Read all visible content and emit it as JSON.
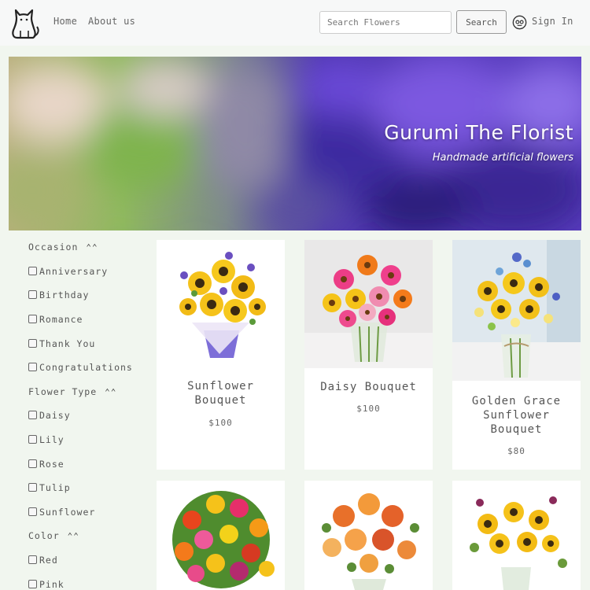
{
  "nav": {
    "links": [
      "Home",
      "About us"
    ],
    "search_placeholder": "Search Flowers",
    "search_button": "Search",
    "signin": "Sign In"
  },
  "hero": {
    "title": "Gurumi The Florist",
    "subtitle": "Handmade artificial flowers"
  },
  "filters": {
    "occasion": {
      "label": "Occasion",
      "options": [
        "Anniversary",
        "Birthday",
        "Romance",
        "Thank You",
        "Congratulations"
      ]
    },
    "flower_type": {
      "label": "Flower Type",
      "options": [
        "Daisy",
        "Lily",
        "Rose",
        "Tulip",
        "Sunflower"
      ]
    },
    "color": {
      "label": "Color",
      "options": [
        "Red",
        "Pink"
      ]
    },
    "collapse_glyph": "⌃⌃"
  },
  "products": [
    {
      "name": "Sunflower Bouquet",
      "price": "$100"
    },
    {
      "name": "Daisy Bouquet",
      "price": "$100"
    },
    {
      "name": "Golden Grace Sunflower Bouquet",
      "price": "$80"
    }
  ],
  "colors": {
    "page_bg": "#f1f6ef",
    "navbar_bg": "#f7f8f8",
    "hero_purple": "#5a3fc4",
    "hero_green": "#9bc26a"
  }
}
